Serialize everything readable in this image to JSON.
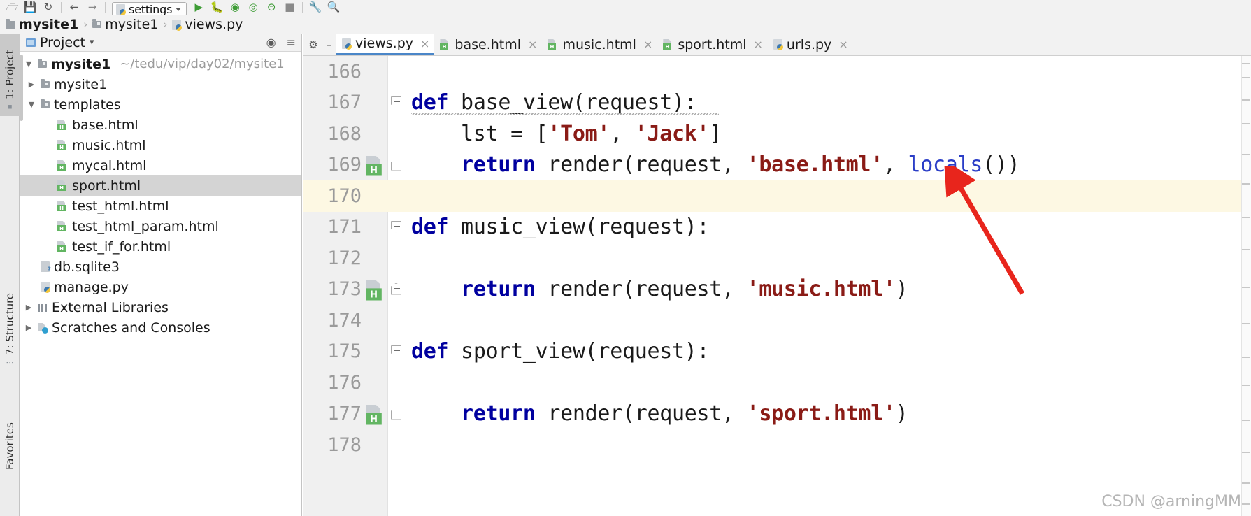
{
  "toolbar": {
    "icons": [
      "open-folder-icon",
      "save-icon",
      "sync-icon"
    ],
    "nav_back": "←",
    "nav_forward": "→",
    "run_config": {
      "label": "settings",
      "icon": "python-file-icon"
    },
    "actions": [
      "run-icon",
      "debug-icon",
      "run-with-coverage-icon",
      "profile-icon",
      "run-queue-icon",
      "stop-icon",
      "wrench-icon",
      "search-icon"
    ]
  },
  "breadcrumb": {
    "items": [
      {
        "label": "mysite1",
        "icon": "folder-icon",
        "bold": true
      },
      {
        "label": "mysite1",
        "icon": "folder-icon",
        "bold": false
      },
      {
        "label": "views.py",
        "icon": "python-file-icon",
        "bold": false
      }
    ],
    "separator": "›"
  },
  "tool_window_tabs": [
    {
      "label": "1: Project",
      "icon": "project-folder-icon",
      "active": true
    },
    {
      "label": "7: Structure",
      "icon": "structure-icon",
      "active": false
    },
    {
      "label": "Favorites",
      "icon": "favorites-icon",
      "active": false
    }
  ],
  "project_panel": {
    "title": "Project",
    "title_caret": "▾",
    "header_icons": [
      "target-icon",
      "collapse-all-icon",
      "settings-gear-icon",
      "hide-icon"
    ],
    "tree": [
      {
        "label": "mysite1",
        "path": "~/tedu/vip/day02/mysite1",
        "icon": "folder-icon",
        "arrow": "▼",
        "indent": 0,
        "bold": true,
        "selected": false
      },
      {
        "label": "mysite1",
        "path": "",
        "icon": "folder-icon",
        "arrow": "▶",
        "indent": 1,
        "bold": false,
        "selected": false
      },
      {
        "label": "templates",
        "path": "",
        "icon": "folder-icon",
        "arrow": "▼",
        "indent": 1,
        "bold": false,
        "selected": false
      },
      {
        "label": "base.html",
        "path": "",
        "icon": "html-file-icon",
        "arrow": "",
        "indent": 2,
        "bold": false,
        "selected": false
      },
      {
        "label": "music.html",
        "path": "",
        "icon": "html-file-icon",
        "arrow": "",
        "indent": 2,
        "bold": false,
        "selected": false
      },
      {
        "label": "mycal.html",
        "path": "",
        "icon": "html-file-icon",
        "arrow": "",
        "indent": 2,
        "bold": false,
        "selected": false
      },
      {
        "label": "sport.html",
        "path": "",
        "icon": "html-file-icon",
        "arrow": "",
        "indent": 2,
        "bold": false,
        "selected": true
      },
      {
        "label": "test_html.html",
        "path": "",
        "icon": "html-file-icon",
        "arrow": "",
        "indent": 2,
        "bold": false,
        "selected": false
      },
      {
        "label": "test_html_param.html",
        "path": "",
        "icon": "html-file-icon",
        "arrow": "",
        "indent": 2,
        "bold": false,
        "selected": false
      },
      {
        "label": "test_if_for.html",
        "path": "",
        "icon": "html-file-icon",
        "arrow": "",
        "indent": 2,
        "bold": false,
        "selected": false
      },
      {
        "label": "db.sqlite3",
        "path": "",
        "icon": "db-file-icon",
        "arrow": "",
        "indent": 1,
        "bold": false,
        "selected": false
      },
      {
        "label": "manage.py",
        "path": "",
        "icon": "python-file-icon",
        "arrow": "",
        "indent": 1,
        "bold": false,
        "selected": false
      },
      {
        "label": "External Libraries",
        "path": "",
        "icon": "library-icon",
        "arrow": "▶",
        "indent": 0,
        "bold": false,
        "selected": false
      },
      {
        "label": "Scratches and Consoles",
        "path": "",
        "icon": "scratch-icon",
        "arrow": "▶",
        "indent": 0,
        "bold": false,
        "selected": false
      }
    ]
  },
  "editor": {
    "gear_icon": "settings-gear-icon",
    "minimize_icon": "minimize-icon",
    "tabs": [
      {
        "label": "views.py",
        "icon": "python-file-icon",
        "active": true,
        "close": "×"
      },
      {
        "label": "base.html",
        "icon": "html-file-icon",
        "active": false,
        "close": "×"
      },
      {
        "label": "music.html",
        "icon": "html-file-icon",
        "active": false,
        "close": "×"
      },
      {
        "label": "sport.html",
        "icon": "html-file-icon",
        "active": false,
        "close": "×"
      },
      {
        "label": "urls.py",
        "icon": "python-file-icon",
        "active": false,
        "close": "×"
      }
    ],
    "lines": [
      {
        "num": "166",
        "text": "",
        "highlight": false,
        "marker": "",
        "fold": ""
      },
      {
        "num": "167",
        "text": "def base_view(request):",
        "highlight": false,
        "marker": "",
        "fold": "start"
      },
      {
        "num": "168",
        "text": "    lst = ['Tom', 'Jack']",
        "highlight": false,
        "marker": "",
        "fold": ""
      },
      {
        "num": "169",
        "text": "    return render(request, 'base.html', locals())",
        "highlight": false,
        "marker": "html-file-icon",
        "fold": "end"
      },
      {
        "num": "170",
        "text": "",
        "highlight": true,
        "marker": "",
        "fold": ""
      },
      {
        "num": "171",
        "text": "def music_view(request):",
        "highlight": false,
        "marker": "",
        "fold": "start"
      },
      {
        "num": "172",
        "text": "",
        "highlight": false,
        "marker": "",
        "fold": ""
      },
      {
        "num": "173",
        "text": "    return render(request, 'music.html')",
        "highlight": false,
        "marker": "html-file-icon",
        "fold": "end"
      },
      {
        "num": "174",
        "text": "",
        "highlight": false,
        "marker": "",
        "fold": ""
      },
      {
        "num": "175",
        "text": "def sport_view(request):",
        "highlight": false,
        "marker": "",
        "fold": "start"
      },
      {
        "num": "176",
        "text": "",
        "highlight": false,
        "marker": "",
        "fold": ""
      },
      {
        "num": "177",
        "text": "    return render(request, 'sport.html')",
        "highlight": false,
        "marker": "html-file-icon",
        "fold": "end"
      },
      {
        "num": "178",
        "text": "",
        "highlight": false,
        "marker": "",
        "fold": ""
      }
    ]
  },
  "annotation": {
    "type": "arrow",
    "color": "#e8251c",
    "points_to": "locals-call"
  },
  "watermark": {
    "text": "CSDN @arningMM"
  },
  "colors": {
    "keyword": "#00009f",
    "string": "#8a1b16",
    "builtin": "#2b3ec7",
    "selection": "#d4d4d4",
    "current_line": "#fdf8e3",
    "active_tab_underline": "#4a86c8",
    "html_icon_green": "#62b562",
    "annotation_red": "#e8251c"
  }
}
